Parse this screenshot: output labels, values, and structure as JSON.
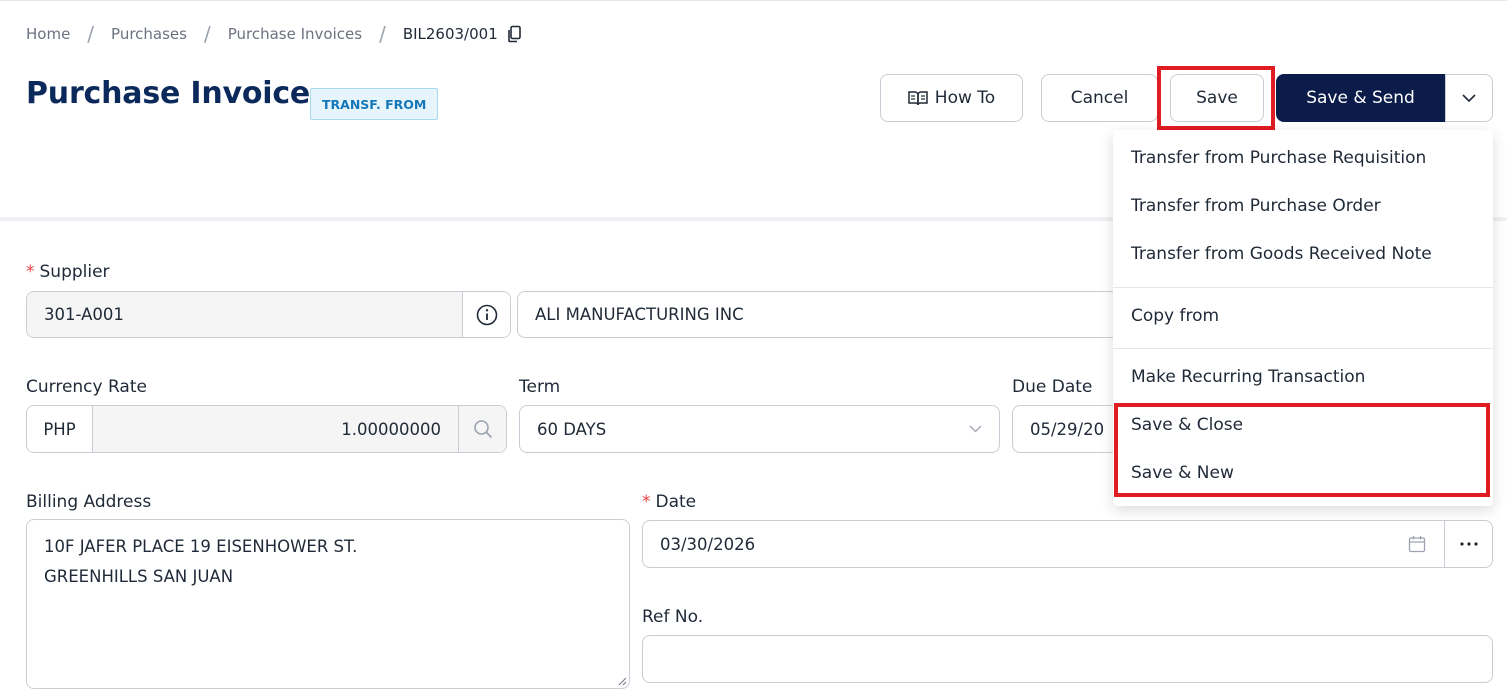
{
  "breadcrumb": {
    "items": [
      "Home",
      "Purchases",
      "Purchase Invoices"
    ],
    "current": "BIL2603/001"
  },
  "header": {
    "title": "Purchase Invoice",
    "badge": "TRANSF. FROM"
  },
  "toolbar": {
    "how_to": "How To",
    "cancel": "Cancel",
    "save": "Save",
    "save_send": "Save & Send"
  },
  "menu": {
    "items": [
      "Transfer from Purchase Requisition",
      "Transfer from Purchase Order",
      "Transfer from Goods Received Note",
      "Copy from",
      "Make Recurring Transaction",
      "Save & Close",
      "Save & New"
    ]
  },
  "form": {
    "supplier": {
      "label": "Supplier",
      "code": "301-A001",
      "name": "ALI MANUFACTURING INC"
    },
    "currency": {
      "label": "Currency Rate",
      "code": "PHP",
      "rate": "1.00000000"
    },
    "term": {
      "label": "Term",
      "value": "60 DAYS"
    },
    "due_date": {
      "label": "Due Date",
      "value": "05/29/20"
    },
    "billing_address": {
      "label": "Billing Address",
      "line1": "10F JAFER PLACE 19 EISENHOWER ST.",
      "line2": "GREENHILLS SAN JUAN"
    },
    "date": {
      "label": "Date",
      "value": "03/30/2026"
    },
    "ref_no": {
      "label": "Ref No.",
      "value": ""
    }
  },
  "colors": {
    "title": "#0b2a5b",
    "primary_button": "#0b1b4a",
    "highlight": "#e11b22",
    "required": "#ef4444",
    "badge_text": "#1677b8"
  }
}
